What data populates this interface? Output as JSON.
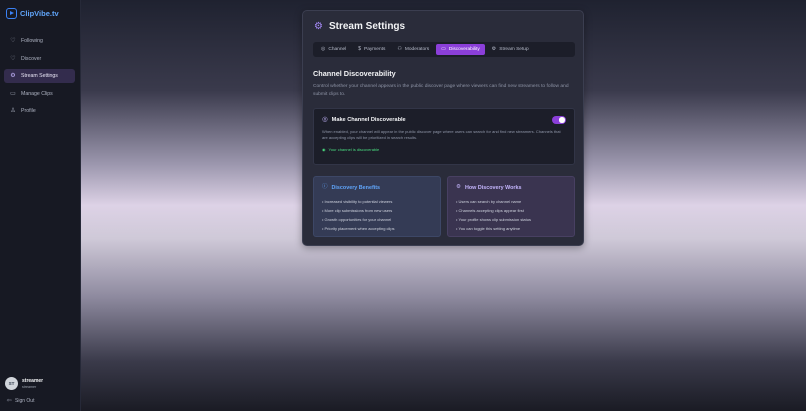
{
  "app": {
    "name": "ClipVibe.tv"
  },
  "sidebar": {
    "items": [
      {
        "label": "Following",
        "icon": "heart-icon"
      },
      {
        "label": "Discover",
        "icon": "heart-icon"
      },
      {
        "label": "Stream Settings",
        "icon": "gear-icon",
        "active": true
      },
      {
        "label": "Manage Clips",
        "icon": "video-icon"
      },
      {
        "label": "Profile",
        "icon": "user-icon"
      }
    ],
    "user": {
      "initials": "ST",
      "name": "streamer",
      "role": "streamer"
    },
    "signout_label": "Sign Out"
  },
  "card": {
    "title": "Stream Settings",
    "tabs": [
      {
        "label": "Channel",
        "icon": "globe-icon"
      },
      {
        "label": "Payments",
        "icon": "dollar-icon"
      },
      {
        "label": "Moderators",
        "icon": "users-icon"
      },
      {
        "label": "Discoverability",
        "icon": "monitor-icon",
        "active": true
      },
      {
        "label": "Stream Setup",
        "icon": "gear-icon"
      }
    ],
    "section_title": "Channel Discoverability",
    "section_desc": "Control whether your channel appears in the public discover page where viewers can find new streamers to follow and submit clips to.",
    "panel": {
      "title": "Make Channel Discoverable",
      "toggle_on": true,
      "desc": "When enabled, your channel will appear in the public discover page where users can search for and find new streamers. Channels that are accepting clips will be prioritized in search results.",
      "status": "Your channel is discoverable"
    },
    "benefits": {
      "title": "Discovery Benefits",
      "items": [
        "• Increased visibility to potential viewers",
        "• More clip submissions from new users",
        "• Growth opportunities for your channel",
        "• Priority placement when accepting clips"
      ]
    },
    "how": {
      "title": "How Discovery Works",
      "items": [
        "• Users can search by channel name",
        "• Channels accepting clips appear first",
        "• Your profile shows clip submission status",
        "• You can toggle this setting anytime"
      ]
    }
  },
  "colors": {
    "accent": "#8b3fd9",
    "brand": "#3b82f6",
    "success": "#4ade80"
  }
}
